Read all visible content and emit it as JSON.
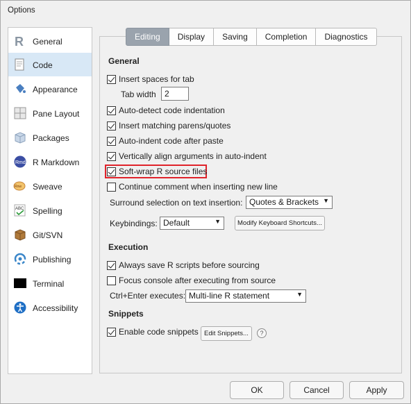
{
  "window": {
    "title": "Options"
  },
  "sidebar": {
    "items": [
      {
        "label": "General",
        "icon": "r-logo-icon"
      },
      {
        "label": "Code",
        "icon": "code-document-icon",
        "selected": true
      },
      {
        "label": "Appearance",
        "icon": "paint-bucket-icon"
      },
      {
        "label": "Pane Layout",
        "icon": "pane-layout-icon"
      },
      {
        "label": "Packages",
        "icon": "package-box-icon"
      },
      {
        "label": "R Markdown",
        "icon": "rmd-icon"
      },
      {
        "label": "Sweave",
        "icon": "sweave-icon"
      },
      {
        "label": "Spelling",
        "icon": "spellcheck-icon"
      },
      {
        "label": "Git/SVN",
        "icon": "git-svn-box-icon"
      },
      {
        "label": "Publishing",
        "icon": "publishing-icon"
      },
      {
        "label": "Terminal",
        "icon": "terminal-icon"
      },
      {
        "label": "Accessibility",
        "icon": "accessibility-icon"
      }
    ]
  },
  "tabs": [
    "Editing",
    "Display",
    "Saving",
    "Completion",
    "Diagnostics"
  ],
  "active_tab": "Editing",
  "general": {
    "heading": "General",
    "insert_spaces": "Insert spaces for tab",
    "tab_width_label": "Tab width",
    "tab_width_value": "2",
    "auto_detect": "Auto-detect code indentation",
    "insert_matching": "Insert matching parens/quotes",
    "auto_indent": "Auto-indent code after paste",
    "vertically_align": "Vertically align arguments in auto-indent",
    "soft_wrap": "Soft-wrap R source files",
    "continue_comment": "Continue comment when inserting new line",
    "surround_label": "Surround selection on text insertion:",
    "surround_value": "Quotes & Brackets",
    "keybindings_label": "Keybindings:",
    "keybindings_value": "Default",
    "modify_shortcuts": "Modify Keyboard Shortcuts..."
  },
  "execution": {
    "heading": "Execution",
    "always_save": "Always save R scripts before sourcing",
    "focus_console": "Focus console after executing from source",
    "ctrl_enter_label": "Ctrl+Enter executes:",
    "ctrl_enter_value": "Multi-line R statement"
  },
  "snippets": {
    "heading": "Snippets",
    "enable": "Enable code snippets",
    "edit_button": "Edit Snippets...",
    "help": "?"
  },
  "footer": {
    "ok": "OK",
    "cancel": "Cancel",
    "apply": "Apply"
  },
  "colors": {
    "selected_bg": "#d8e8f6",
    "active_tab_bg": "#9aa3ad",
    "highlight": "#e0222a"
  }
}
